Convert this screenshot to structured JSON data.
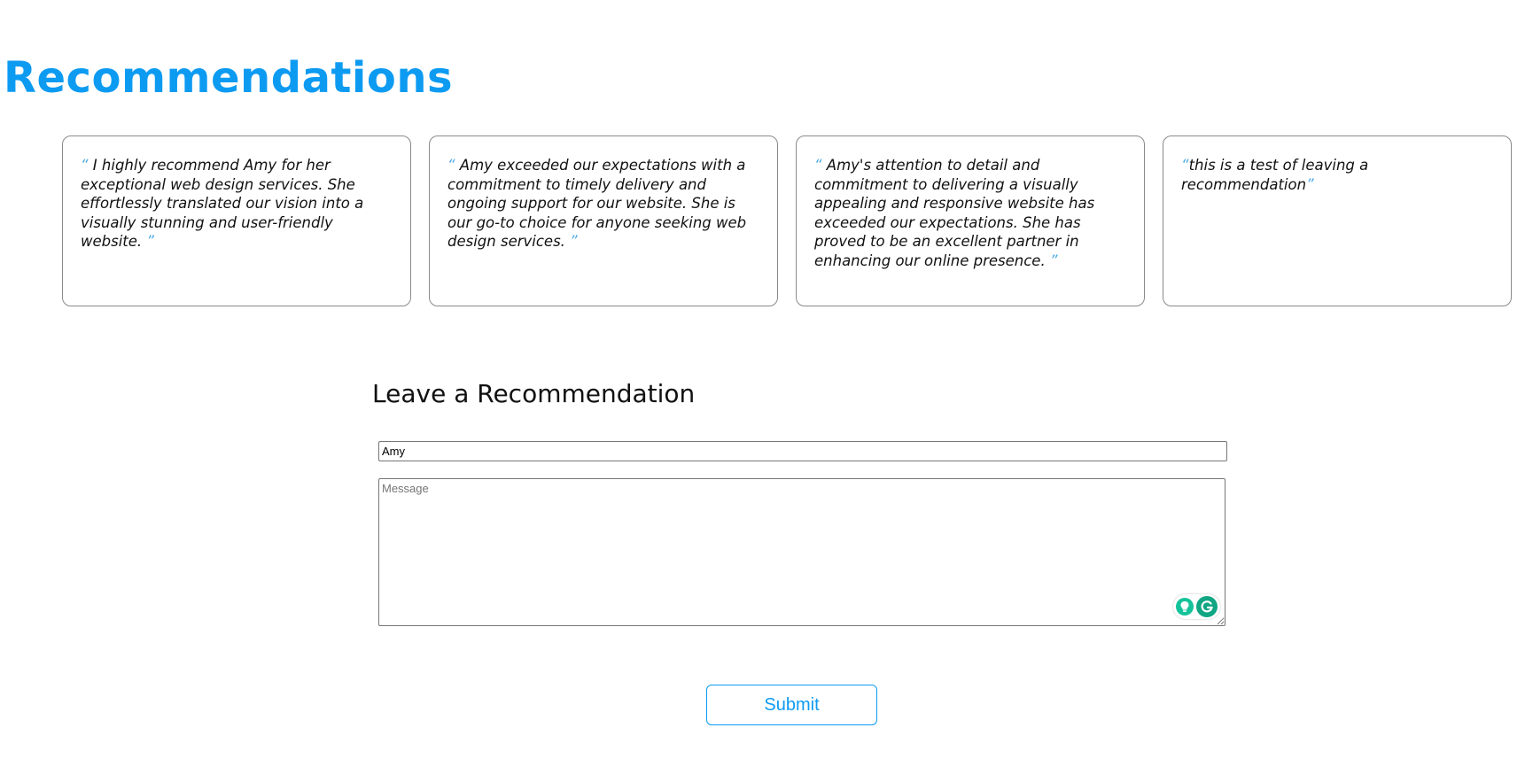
{
  "header": {
    "title": "Recommendations"
  },
  "recommendations": [
    {
      "open_quote": "“",
      "text": " I highly recommend Amy for her exceptional web design services. She effortlessly translated our vision into a visually stunning and user-friendly website. ",
      "close_quote": "”"
    },
    {
      "open_quote": "“",
      "text": " Amy exceeded our expectations with a commitment to timely delivery and ongoing support for our website. She is our go-to choice for anyone seeking web design services. ",
      "close_quote": "”"
    },
    {
      "open_quote": "“",
      "text": " Amy's attention to detail and commitment to delivering a visually appealing and responsive website has exceeded our expectations. She has proved to be an excellent partner in enhancing our online presence. ",
      "close_quote": "”"
    },
    {
      "open_quote": "“",
      "text": "this is a test of leaving a recommendation",
      "close_quote": "”"
    }
  ],
  "form": {
    "title": "Leave a Recommendation",
    "name_value": "Amy",
    "message_placeholder": "Message",
    "message_value": "",
    "submit_label": "Submit"
  },
  "colors": {
    "accent": "#0d9bf2",
    "quote_mark": "#4aa8e8",
    "card_border": "#8a8a8a",
    "grammarly_green": "#11a683"
  },
  "icons": {
    "grammarly_suggestion": "lightbulb-icon",
    "grammarly_logo": "grammarly-g-icon"
  }
}
